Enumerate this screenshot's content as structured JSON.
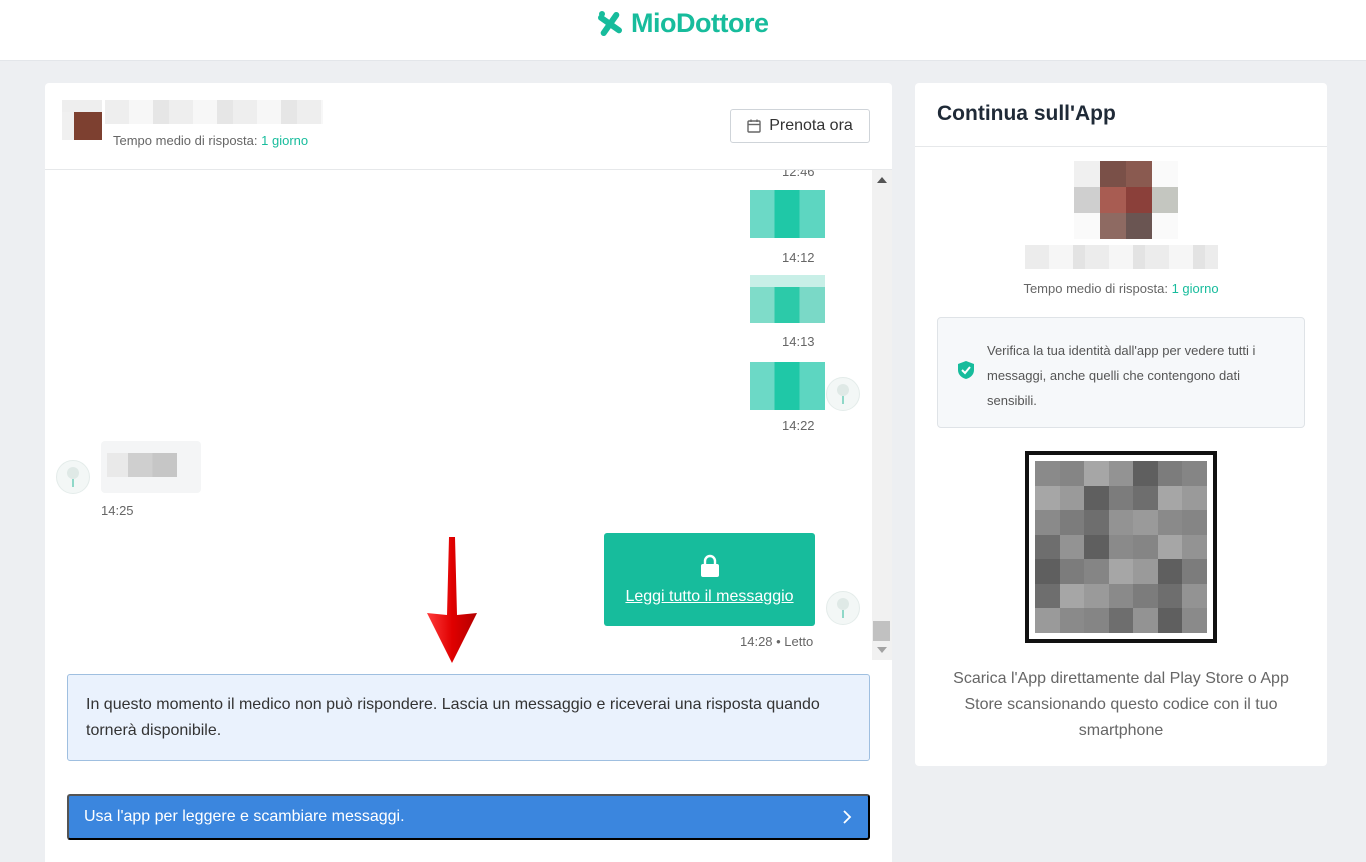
{
  "topbar": {
    "brand": "MioDottore",
    "brand_color": "#17bc9c",
    "icon": "miodottore-logo-icon"
  },
  "chat": {
    "header": {
      "response_label": "Tempo medio di risposta:",
      "response_value": "1 giorno",
      "book_button": "Prenota ora"
    },
    "messages": [
      {
        "time": "12:46"
      },
      {
        "time": "14:12"
      },
      {
        "time": "14:13"
      },
      {
        "time": "14:22"
      },
      {
        "time": "14:25"
      }
    ],
    "locked_message": {
      "link": "Leggi tutto il messaggio",
      "status": "14:28 • Letto"
    },
    "notice": "In questo momento il medico non può rispondere. Lascia un messaggio e riceverai una risposta quando tornerà disponibile.",
    "app_bar": "Usa l'app per leggere e scambiare messaggi."
  },
  "side": {
    "title": "Continua sull'App",
    "response_label": "Tempo medio di risposta:",
    "response_value": "1 giorno",
    "verify_text": "Verifica la tua identità dall'app per vedere tutti i messaggi, anche quelli che contengono dati sensibili.",
    "footer": "Scarica l'App direttamente dal Play Store o App Store scansionando questo codice con il tuo smartphone"
  },
  "colors": {
    "accent": "#17bc9c",
    "app_bar": "#3b86de",
    "notice_bg": "#eaf2fd",
    "annotation_arrow": "#e00000"
  }
}
